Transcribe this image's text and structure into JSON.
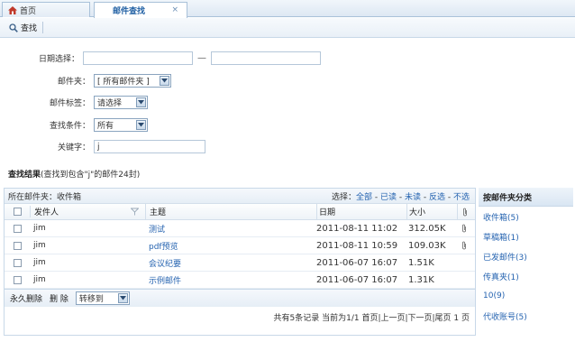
{
  "tabs": [
    {
      "label": "首页"
    },
    {
      "label": "邮件查找",
      "close": "×"
    }
  ],
  "toolbar": {
    "search_label": "查找"
  },
  "form": {
    "date_label": "日期选择：",
    "date_from": "",
    "date_to": "",
    "date_separator": "—",
    "folder_label": "邮件夹：",
    "folder_value": "[ 所有邮件夹 ]",
    "tag_label": "邮件标签：",
    "tag_value": "请选择",
    "condition_label": "查找条件：",
    "condition_value": "所有",
    "keyword_label": "关键字：",
    "keyword_value": "j"
  },
  "result": {
    "title": "查找结果",
    "summary": "(查找到包含\"j\"的邮件24封)"
  },
  "table": {
    "folder_text": "所在邮件夹：收件箱",
    "select_prefix": "选择：",
    "select_links": [
      "全部",
      "已读",
      "未读",
      "反选",
      "不选"
    ],
    "select_sep": " - ",
    "headers": {
      "sender": "发件人",
      "subject": "主题",
      "date": "日期",
      "size": "大小"
    },
    "rows": [
      {
        "sender": "jim",
        "subject": "测试",
        "date": "2011-08-11 11:02",
        "size": "312.05K",
        "attachment": true
      },
      {
        "sender": "jim",
        "subject": "pdf预览",
        "date": "2011-08-11 10:59",
        "size": "109.03K",
        "attachment": true
      },
      {
        "sender": "jim",
        "subject": "会议纪要",
        "date": "2011-06-07 16:07",
        "size": "1.51K",
        "attachment": false
      },
      {
        "sender": "jim",
        "subject": "示例邮件",
        "date": "2011-06-07 16:07",
        "size": "1.31K",
        "attachment": false
      }
    ],
    "actions": {
      "delete_forever": "永久删除",
      "delete": "删 除",
      "move_to": "转移到"
    },
    "pager": "共有5条记录 当前为1/1 首页|上一页|下一页|尾页  1 页"
  },
  "sidebar": {
    "title": "按邮件夹分类",
    "items": [
      "收件箱(5)",
      "草稿箱(1)",
      "已发邮件(3)",
      "传真夹(1)",
      "10(9)",
      "代收账号(5)"
    ]
  },
  "colors": {
    "accent": "#1f5fa3",
    "link": "#2563b0",
    "border": "#a9c1d9"
  }
}
